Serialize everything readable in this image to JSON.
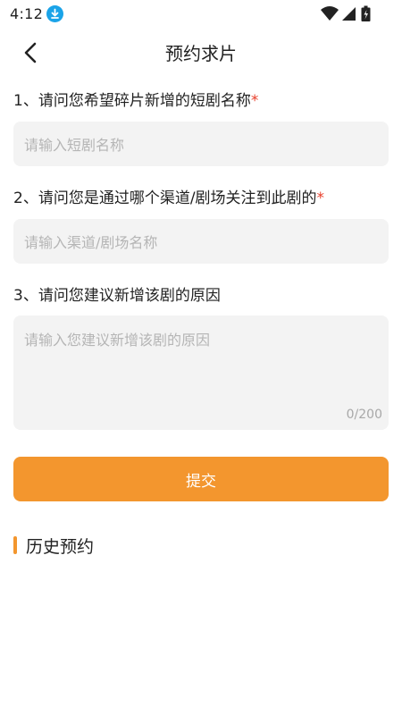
{
  "status_bar": {
    "time": "4:12",
    "icons": [
      "download-icon",
      "wifi-icon",
      "signal-icon",
      "battery-icon"
    ]
  },
  "nav": {
    "back_icon": "chevron-left-icon",
    "title": "预约求片"
  },
  "form": {
    "q1": {
      "label": "1、请问您希望碎片新增的短剧名称",
      "required_mark": "*",
      "placeholder": "请输入短剧名称",
      "value": ""
    },
    "q2": {
      "label": "2、请问您是通过哪个渠道/剧场关注到此剧的",
      "required_mark": "*",
      "placeholder": "请输入渠道/剧场名称",
      "value": ""
    },
    "q3": {
      "label": "3、请问您建议新增该剧的原因",
      "placeholder": "请输入您建议新增该剧的原因",
      "value": "",
      "counter": "0/200"
    },
    "submit_label": "提交"
  },
  "history": {
    "title": "历史预约"
  },
  "colors": {
    "accent": "#f3962e",
    "required": "#e83e2a",
    "input_bg": "#f3f3f3",
    "placeholder": "#b5b5b5",
    "download_badge": "#1aa3e8"
  }
}
